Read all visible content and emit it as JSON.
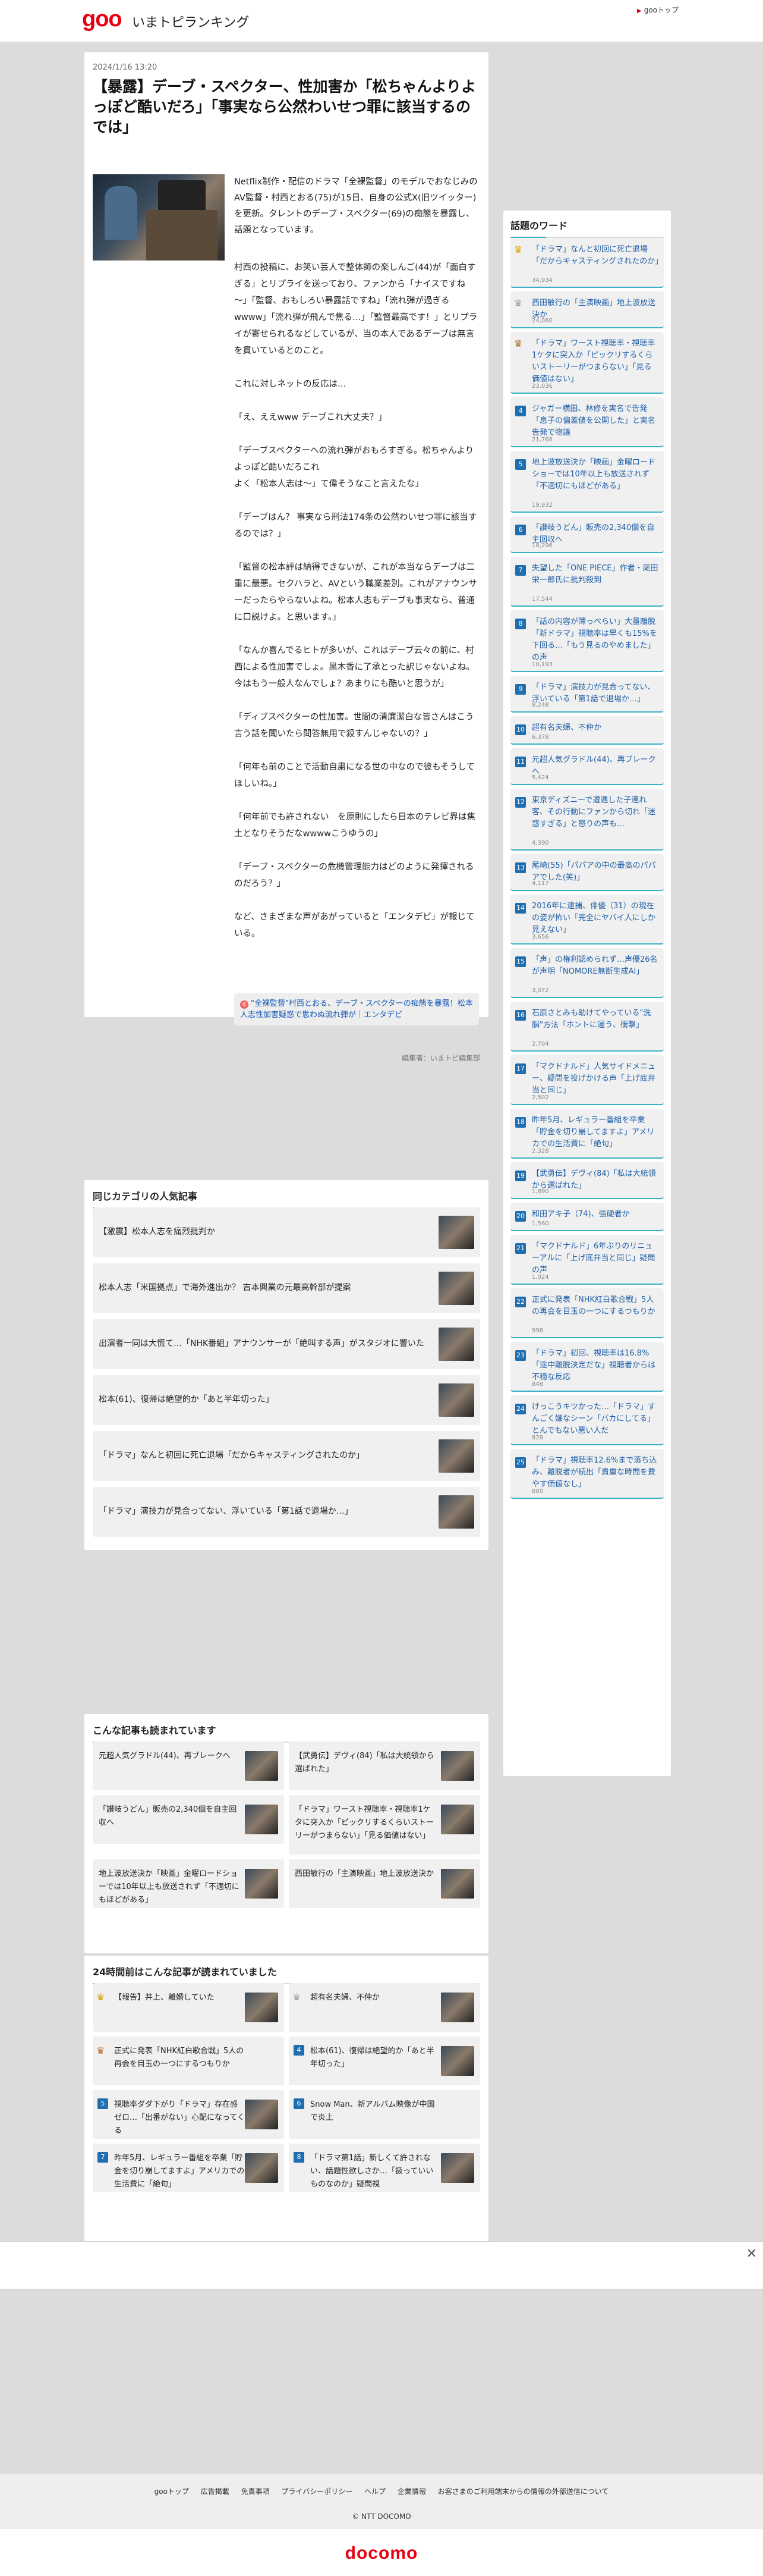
{
  "header": {
    "logo": "goo",
    "site_title": "いまトピランキング",
    "goo_top": "gooトップ"
  },
  "article": {
    "date": "2024/1/16 13:20",
    "headline": "【暴露】デーブ・スペクター、性加害か「松ちゃんよりよっぽど酷いだろ」「事実なら公然わいせつ罪に該当するのでは」",
    "lead": "Netflix制作・配信のドラマ「全裸監督」のモデルでおなじみのAV監督・村西とおる(75)が15日、自身の公式X(旧ツイッター)を更新。タレントのデーブ・スペクター(69)の痴態を暴露し、話題となっています。",
    "paragraphs": [
      "村西の投稿に、お笑い芸人で整体師の楽しんご(44)が「面白すぎる」とリプライを送っており、ファンから「ナイスですね～」「監督、おもしろい暴露話ですね」「流れ弾が過ぎるwwww」「流れ弾が飛んで焦る…」「監督最高です！」とリプライが寄せられるなどしているが、当の本人であるデーブは無言を貫いているとのこと。",
      "これに対しネットの反応は…",
      "「え、ええwww デーブこれ大丈夫？」",
      "「デーブスペクターへの流れ弾がおもろすぎる。松ちゃんよりよっぽど酷いだろこれ\nよく「松本人志は～」て偉そうなこと言えたな」",
      "「デーブはん？ 事実なら刑法174条の公然わいせつ罪に該当するのでは？」",
      "「監督の松本評は納得できないが、これが本当ならデーブは二重に最悪。セクハラと、AVという職業差別。これがアナウンサーだったらやらないよね。松本人志もデーブも事実なら、普通に口説けよ。と思います。」",
      "「なんか喜んでるヒトが多いが、これはデーブ云々の前に、村西による性加害でしょ。黒木香に了承とった訳じゃないよね。今はもう一般人なんでしょ？あまりにも酷いと思うが」",
      "「ディブスペクターの性加害。世間の清廉潔白な皆さんはこう言う話を聞いたら問答無用で殺すんじゃないの？」",
      "「何年も前のことで活動自粛になる世の中なので彼もそうしてほしいね。」",
      "「何年前でも許されない　を原則にしたら日本のテレビ界は焦土となりそうだなwwwwこうゆうの」",
      "「デーブ・スペクターの危機管理能力はどのように発揮されるのだろう？」",
      "など、さまざまな声があがっていると「エンタデビ」が報じている。"
    ],
    "related": "\"全裸監督\"村西とおる、デーブ・スペクターの痴態を暴露！松本人志性加害疑惑で思わぬ流れ弾が｜エンタデビ",
    "editor": "編集者：いまトピ編集部"
  },
  "same_category": {
    "title": "同じカテゴリの人気記事",
    "items": [
      "【激震】松本人志を痛烈批判か",
      "松本人志「米国拠点」で海外進出か？ 吉本興業の元最高幹部が提案",
      "出演者一同は大慌て…「NHK番組」アナウンサーが「絶叫する声」がスタジオに響いた",
      "松本(61)、復帰は絶望的か「あと半年切った」",
      "「ドラマ」なんと初回に死亡退場「だからキャスティングされたのか」",
      "「ドラマ」演技力が見合ってない、浮いている「第1話で退場か…」"
    ]
  },
  "also_read": {
    "title": "こんな記事も読まれています",
    "items": [
      "元超人気グラドル(44)、再ブレークへ",
      "【武勇伝】デヴィ(84)「私は大統領から選ばれた」",
      "「讃岐うどん」販売の2,340個を自主回収へ",
      "「ドラマ」ワースト視聴率・視聴率1ケタに突入か「ピックリするくらいストーリーがつまらない」「見る価値はない」",
      "地上波放送決か「映画」金曜ロードショーでは10年以上も放送されず「不適切にもほどがある」",
      "西田敏行の「主演映画」地上波放送決か"
    ]
  },
  "h24": {
    "title": "24時間前はこんな記事が読まれていました",
    "items": [
      {
        "rank": "1",
        "text": "【報告】井上、離婚していた"
      },
      {
        "rank": "2",
        "text": "超有名夫婦、不仲か"
      },
      {
        "rank": "3",
        "text": "正式に発表「NHK紅白歌合戦」5人の再会を目玉の一つにするつもりか"
      },
      {
        "rank": "4",
        "text": "松本(61)、復帰は絶望的か「あと半年切った」"
      },
      {
        "rank": "5",
        "text": "視聴率ダダ下がり「ドラマ」存在感ゼロ…「出番がない」心配になってくる"
      },
      {
        "rank": "6",
        "text": "Snow Man、新アルバム映像が中国で炎上"
      },
      {
        "rank": "7",
        "text": "昨年5月、レギュラー番組を卒業「貯金を切り崩してますよ」アメリカでの生活費に「絶句」"
      },
      {
        "rank": "8",
        "text": "「ドラマ第1話」新しくて許されない、話題性欲しさか…「扱っていいものなのか」疑問視"
      }
    ]
  },
  "sidebar": {
    "title": "話題のワード",
    "items": [
      {
        "rank": "1",
        "text": "「ドラマ」なんと初回に死亡退場「だからキャスティングされたのか」",
        "count": "34,934"
      },
      {
        "rank": "2",
        "text": "西田敏行の「主演映画」地上波放送決か",
        "count": "24,080"
      },
      {
        "rank": "3",
        "text": "「ドラマ」ワースト視聴率・視聴率1ケタに突入か「ピックリするくらいストーリーがつまらない」「見る価値はない」",
        "count": "23,036"
      },
      {
        "rank": "4",
        "text": "ジャガー横田、林修を実名で告発「息子の偏差値を公開した」と実名告発で物議",
        "count": "21,768"
      },
      {
        "rank": "5",
        "text": "地上波放送決か「映画」金曜ロードショーでは10年以上も放送されず「不適切にもほどがある」",
        "count": "19,932"
      },
      {
        "rank": "6",
        "text": "「讃岐うどん」販売の2,340個を自主回収へ",
        "count": "18,296"
      },
      {
        "rank": "7",
        "text": "失望した「ONE PIECE」作者・尾田栄一郎氏に批判殺到",
        "count": "17,544"
      },
      {
        "rank": "8",
        "text": "「話の内容が薄っぺらい」大量離脱「新ドラマ」視聴率は早くも15%を下回る…「もう見るのやめました」の声",
        "count": "10,193"
      },
      {
        "rank": "9",
        "text": "「ドラマ」演技力が見合ってない、浮いている「第1話で退場か…」",
        "count": "8,248"
      },
      {
        "rank": "10",
        "text": "超有名夫婦、不仲か",
        "count": "6,378"
      },
      {
        "rank": "11",
        "text": "元超人気グラドル(44)、再ブレークへ",
        "count": "5,424"
      },
      {
        "rank": "12",
        "text": "東京ディズニーで遭遇した子連れ客、その行動にファンから切れ「迷惑すぎる」と怒りの声も…",
        "count": "4,390"
      },
      {
        "rank": "13",
        "text": "尾崎(55)「パパアの中の最高のパパアでした(笑)」",
        "count": "4,117"
      },
      {
        "rank": "14",
        "text": "2016年に逮捕、俳優（31）の現在の姿が怖い「完全にヤバイ人にしか見えない」",
        "count": "3,656"
      },
      {
        "rank": "15",
        "text": "「声」の権利認められず…声優26名が声明「NOMORE無断生成AI」",
        "count": "3,072"
      },
      {
        "rank": "16",
        "text": "石原さとみも助けてやっている\"洗脳\"方法「ホントに運う、衝撃」",
        "count": "2,704"
      },
      {
        "rank": "17",
        "text": "「マクドナルド」人気サイドメニュー、疑問を投げかける声「上げ底弁当と同じ」",
        "count": "2,502"
      },
      {
        "rank": "18",
        "text": "昨年5月、レギュラー番組を卒業「貯金を切り崩してますよ」アメリカでの生活費に「絶句」",
        "count": "2,328"
      },
      {
        "rank": "19",
        "text": "【武勇伝】デヴィ(84)「私は大統領から選ばれた」",
        "count": "1,890"
      },
      {
        "rank": "20",
        "text": "和田アキ子（74)、強硬者か",
        "count": "1,560"
      },
      {
        "rank": "21",
        "text": "「マクドナルド」6年ぶりのリニューアルに「上げ底弁当と同じ」疑問の声",
        "count": "1,024"
      },
      {
        "rank": "22",
        "text": "正式に発表「NHK紅白歌合戦」5人の再会を目玉の一つにするつもりか",
        "count": "998"
      },
      {
        "rank": "23",
        "text": "「ドラマ」初回、視聴率は16.8%「途中離脱決定だな」視聴者からは不穏な反応",
        "count": "848"
      },
      {
        "rank": "24",
        "text": "けっこうキツかった…「ドラマ」すんごく嫌なシーン「バカにしてる」とんでもない悪い人だ",
        "count": "828"
      },
      {
        "rank": "25",
        "text": "「ドラマ」視聴率12.6%まで落ち込み、離脱者が続出「貴重な時間を費やす価値なし」",
        "count": "800"
      }
    ]
  },
  "footer": {
    "links": [
      "gooトップ",
      "広告掲載",
      "免責事項",
      "プライバシーポリシー",
      "ヘルプ",
      "企業情報",
      "お客さまのご利用端末からの情報の外部送信について"
    ],
    "copyright": "© NTT DOCOMO",
    "brand": "docomo"
  },
  "ad": {
    "close": "✕"
  }
}
